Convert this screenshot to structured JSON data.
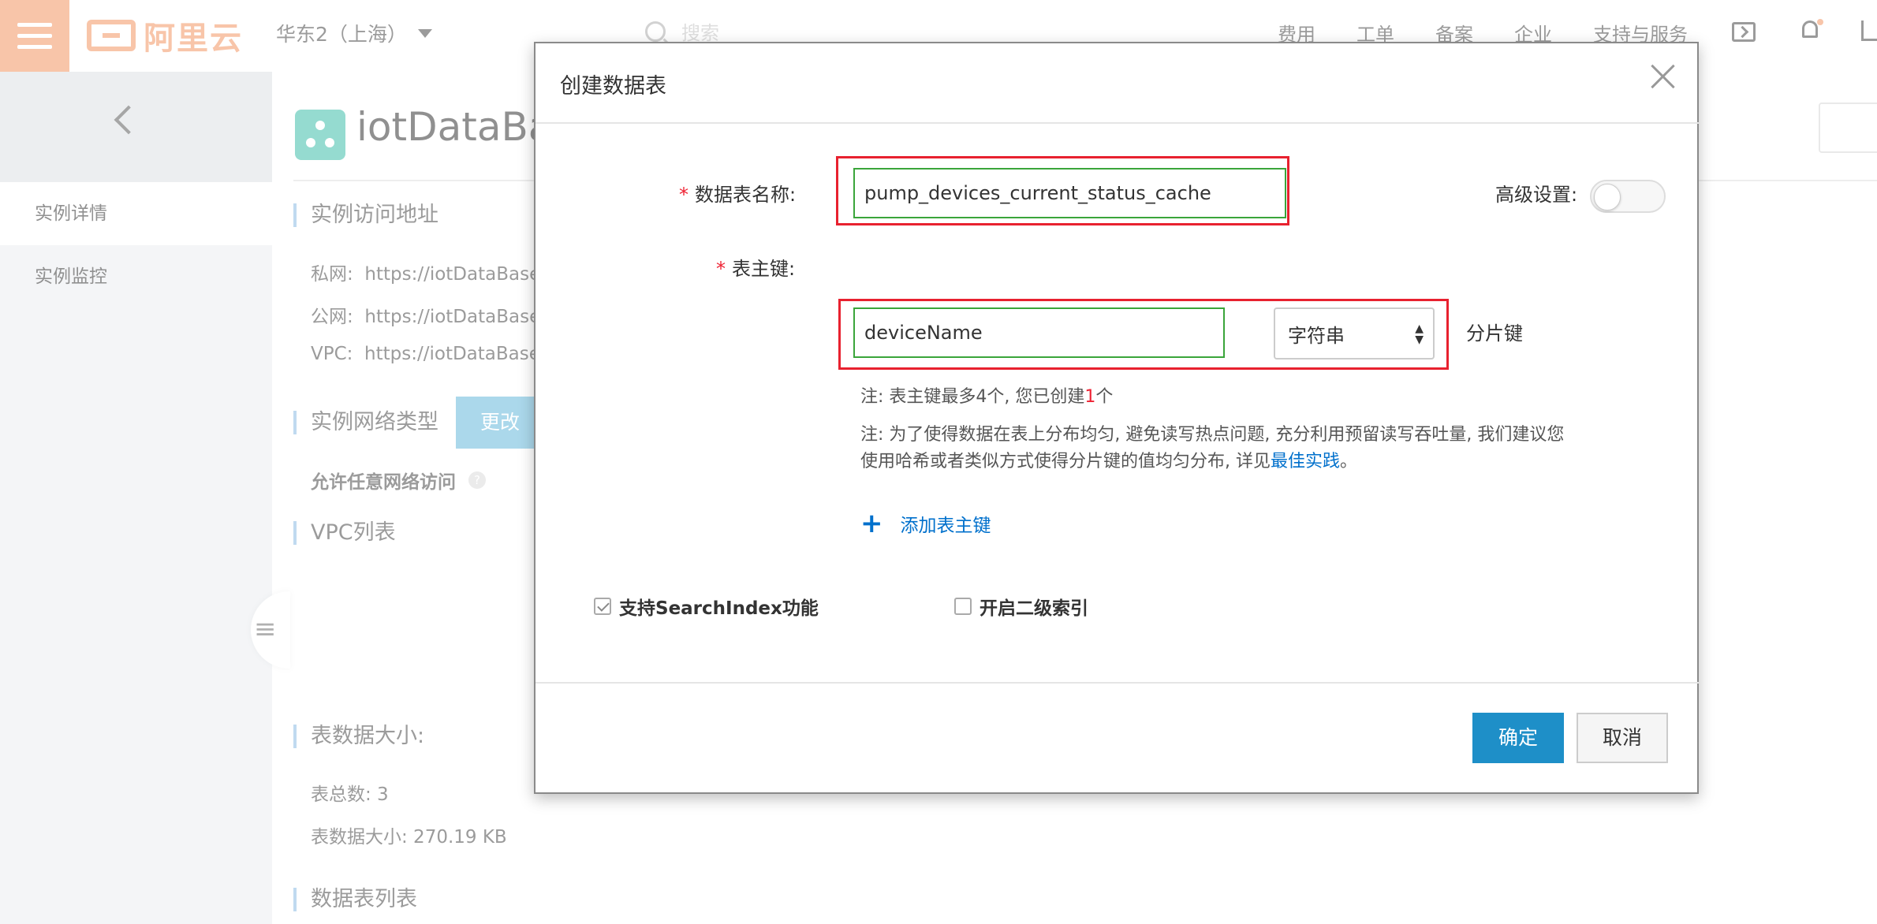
{
  "header": {
    "logo_text": "阿里云",
    "region": "华东2（上海）",
    "search_placeholder": "搜索",
    "nav": [
      "费用",
      "工单",
      "备案",
      "企业",
      "支持与服务"
    ]
  },
  "sidebar": {
    "items": [
      {
        "label": "实例详情"
      },
      {
        "label": "实例监控"
      }
    ]
  },
  "main": {
    "instance_title": "iotDataBase",
    "sections": {
      "access": "实例访问地址",
      "network_type": "实例网络类型",
      "vpc_list": "VPC列表",
      "table_size": "表数据大小:",
      "table_list": "数据表列表"
    },
    "access_rows": [
      {
        "label": "私网:",
        "value": "https://iotDataBase"
      },
      {
        "label": "公网:",
        "value": "https://iotDataBase"
      },
      {
        "label": "VPC:",
        "value": "https://iotDataBase"
      }
    ],
    "change_button": "更改",
    "network_desc": "允许任意网络访问",
    "table_count": "表总数: 3",
    "table_size_value": "表数据大小: 270.19 KB"
  },
  "modal": {
    "title": "创建数据表",
    "table_name_label": "数据表名称:",
    "table_name_value": "pump_devices_current_status_cache",
    "advanced_label": "高级设置:",
    "advanced_enabled": false,
    "pk_label": "表主键:",
    "pk_name_value": "deviceName",
    "pk_type_value": "字符串",
    "shard_key_label": "分片键",
    "note1_prefix": "注: 表主键最多4个, 您已创建",
    "note1_count": "1",
    "note1_suffix": "个",
    "note2_line1": "注: 为了使得数据在表上分布均匀, 避免读写热点问题, 充分利用预留读写吞吐量, 我们建议您",
    "note2_line2_prefix": "使用哈希或者类似方式使得分片键的值均匀分布, 详见",
    "note2_link": "最佳实践",
    "note2_line2_suffix": "。",
    "add_pk_label": "添加表主键",
    "searchindex_label": "支持SearchIndex功能",
    "searchindex_checked": true,
    "secondary_index_label": "开启二级索引",
    "secondary_index_checked": false,
    "ok_button": "确定",
    "cancel_button": "取消"
  },
  "colors": {
    "brand_orange": "#f5a77c",
    "primary_blue": "#1e8fc8",
    "highlight_red": "#e8212f",
    "field_green": "#3aa53a"
  }
}
